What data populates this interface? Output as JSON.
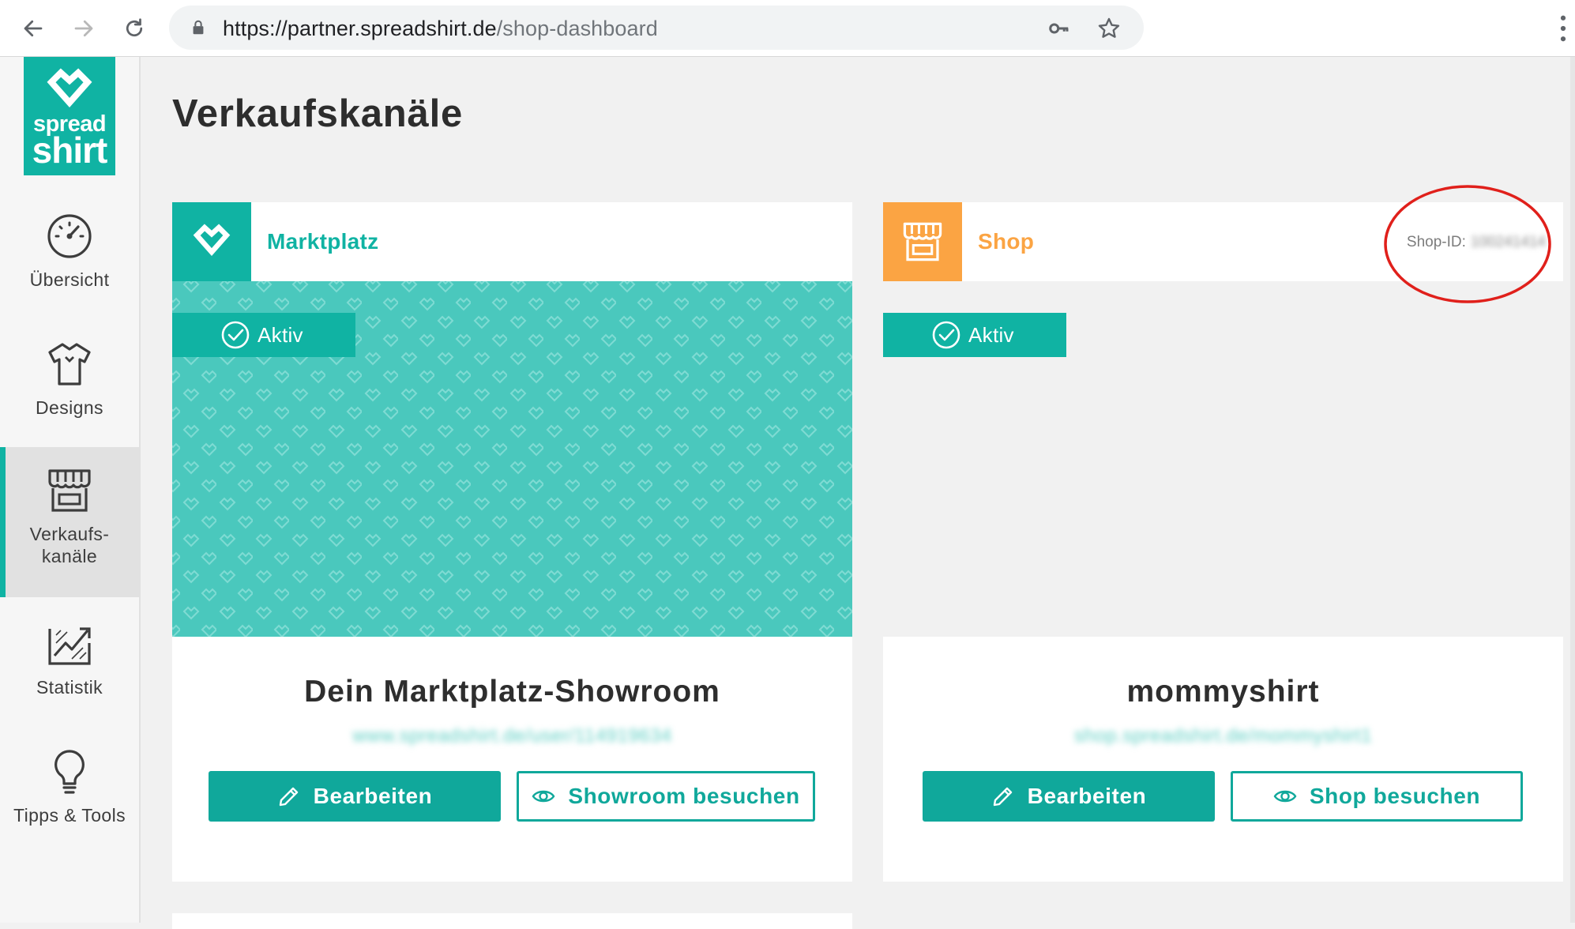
{
  "browser": {
    "url_host": "https://partner.spreadshirt.de",
    "url_path": "/shop-dashboard"
  },
  "logo": {
    "line1": "spread",
    "line2": "shirt"
  },
  "sidebar": {
    "items": [
      {
        "label": "Übersicht",
        "icon": "speedometer-icon"
      },
      {
        "label": "Designs",
        "icon": "tshirt-icon"
      },
      {
        "label": "Verkaufs-\nkanäle",
        "icon": "storefront-icon",
        "active": true
      },
      {
        "label": "Statistik",
        "icon": "chart-icon"
      },
      {
        "label": "Tipps & Tools",
        "icon": "lightbulb-icon"
      }
    ]
  },
  "page": {
    "title": "Verkaufskanäle"
  },
  "marketplace": {
    "header_title": "Marktplatz",
    "status": "Aktiv",
    "name": "Dein Marktplatz-Showroom",
    "url": "www.spreadshirt.de/user/114919634",
    "edit_label": "Bearbeiten",
    "visit_label": "Showroom besuchen"
  },
  "shop": {
    "header_title": "Shop",
    "shop_id_label": "Shop-ID:",
    "shop_id_value": "100241414",
    "status": "Aktiv",
    "name": "mommyshirt",
    "url": "shop.spreadshirt.de/mommyshirt1",
    "edit_label": "Bearbeiten",
    "visit_label": "Shop besuchen"
  },
  "colors": {
    "brand_teal": "#10b3a3",
    "pattern_teal": "#4ac8bd",
    "shop_orange": "#fba443",
    "annotation_red": "#e0201b"
  }
}
